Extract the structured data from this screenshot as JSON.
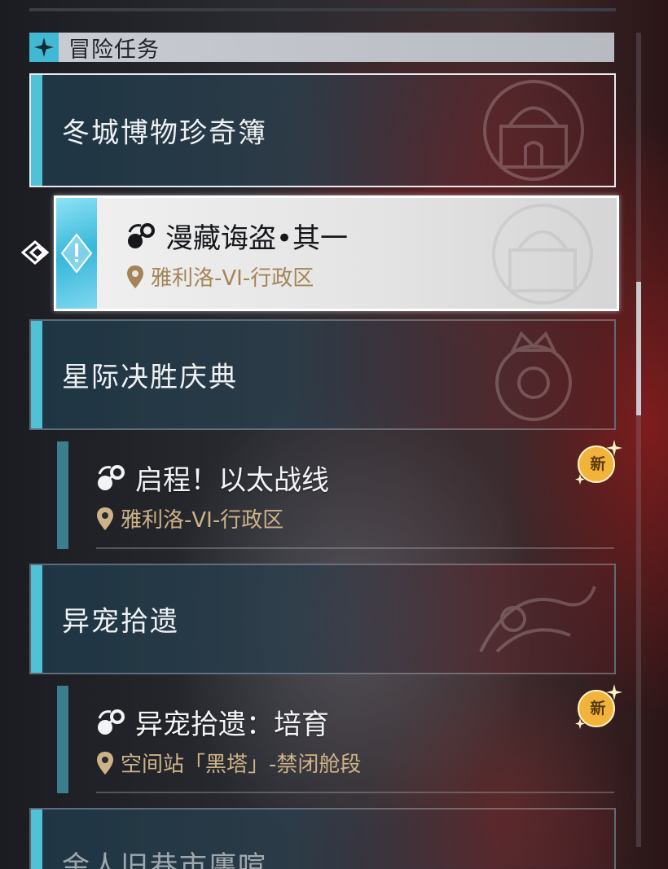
{
  "header": {
    "title": "冒险任务",
    "icon": "sparkle-icon"
  },
  "categories": [
    {
      "label": "冬城博物珍奇簿",
      "emblem": "palace-emblem"
    },
    {
      "label": "星际决胜庆典",
      "emblem": "crown-emblem"
    },
    {
      "label": "异宠拾遗",
      "emblem": "creature-emblem"
    },
    {
      "label": "金人旧巷市廛喧"
    }
  ],
  "quests": [
    {
      "title": "漫藏诲盗•其一",
      "location": "雅利洛-VI-行政区",
      "selected": true
    },
    {
      "title": "启程！以太战线",
      "location": "雅利洛-VI-行政区",
      "badge": "新"
    },
    {
      "title": "异宠拾遗：培育",
      "location": "空间站「黑塔」-禁闭舱段",
      "badge": "新"
    }
  ],
  "colors": {
    "accent": "#4fc2d8",
    "location": "#cdb387",
    "badge": "#f2b33a"
  },
  "scroll": {
    "thumb_fraction_start": 0.31,
    "thumb_fraction_size": 0.16
  }
}
